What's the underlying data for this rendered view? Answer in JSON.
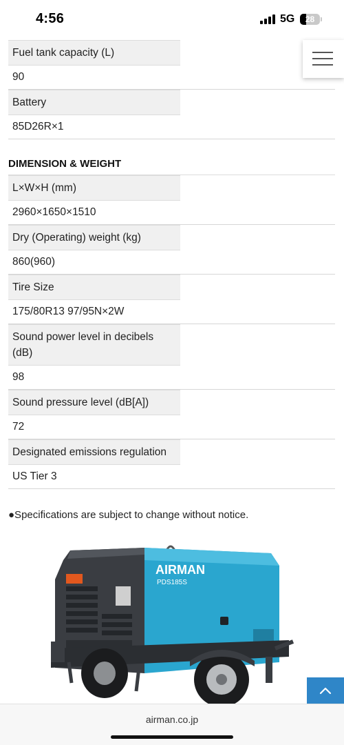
{
  "status_bar": {
    "time": "4:56",
    "network": "5G",
    "battery": "28"
  },
  "specs_top": [
    {
      "label": "Fuel tank capacity (L)",
      "value": "90"
    },
    {
      "label": "Battery",
      "value": "85D26R×1"
    }
  ],
  "dimension_section": {
    "heading": "DIMENSION & WEIGHT",
    "rows": [
      {
        "label": "L×W×H (mm)",
        "value": "2960×1650×1510"
      },
      {
        "label": "Dry (Operating) weight (kg)",
        "value": "860(960)"
      },
      {
        "label": "Tire Size",
        "value": "175/80R13 97/95N×2W"
      },
      {
        "label": "Sound power level in decibels (dB)",
        "value": "98"
      },
      {
        "label": "Sound pressure level (dB[A])",
        "value": "72"
      },
      {
        "label": "Designated emissions regulation",
        "value": "US Tier 3"
      }
    ]
  },
  "note": "●Specifications are subject to change without notice.",
  "product": {
    "brand": "AIRMAN",
    "model": "PDS185S"
  },
  "browser": {
    "url": "airman.co.jp"
  },
  "colors": {
    "accent": "#2f86c8",
    "compressor_body": "#2aa6cf",
    "frame": "#3a3d42"
  },
  "icons": {
    "menu": "hamburger-menu-icon",
    "scroll_top": "chevron-up-icon"
  }
}
